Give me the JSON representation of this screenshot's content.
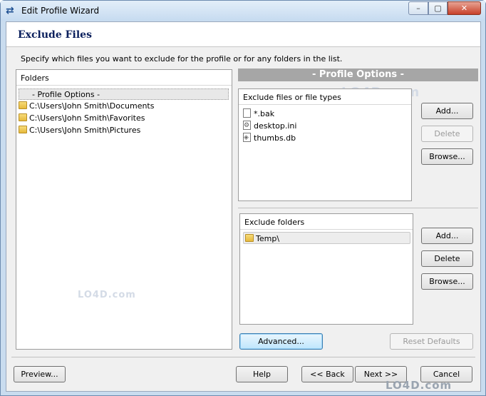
{
  "window": {
    "title": "Edit Profile Wizard",
    "controls": {
      "minimize": "–",
      "maximize": "▢",
      "close": "✕"
    }
  },
  "header": {
    "title": "Exclude Files"
  },
  "instruction": "Specify which files you want to exclude for the profile or for any folders in the list.",
  "folders": {
    "header": "Folders",
    "items": [
      {
        "label": "- Profile Options -",
        "selected": true,
        "icon": "none"
      },
      {
        "label": "C:\\Users\\John Smith\\Documents",
        "icon": "folder-icon"
      },
      {
        "label": "C:\\Users\\John Smith\\Favorites",
        "icon": "folder-icon"
      },
      {
        "label": "C:\\Users\\John Smith\\Pictures",
        "icon": "folder-icon"
      }
    ]
  },
  "profile_options": {
    "label": "- Profile Options -"
  },
  "exclude_files": {
    "header": "Exclude files or file types",
    "items": [
      {
        "label": "*.bak",
        "icon": "file-icon"
      },
      {
        "label": "desktop.ini",
        "icon": "config-file-icon"
      },
      {
        "label": "thumbs.db",
        "icon": "image-file-icon"
      }
    ],
    "buttons": {
      "add": "Add...",
      "delete": "Delete",
      "browse": "Browse..."
    }
  },
  "exclude_folders": {
    "header": "Exclude folders",
    "items": [
      {
        "label": "Temp\\",
        "icon": "folder-icon",
        "selected": true
      }
    ],
    "buttons": {
      "add": "Add...",
      "delete": "Delete",
      "browse": "Browse..."
    }
  },
  "actions": {
    "advanced": "Advanced...",
    "reset_defaults": "Reset Defaults"
  },
  "footer": {
    "preview": "Preview...",
    "help": "Help",
    "back": "<< Back",
    "next": "Next >>",
    "cancel": "Cancel"
  },
  "watermarks": {
    "top": "LO4D.com",
    "middle": "LO4D.com",
    "corner": "LO4D.com"
  }
}
